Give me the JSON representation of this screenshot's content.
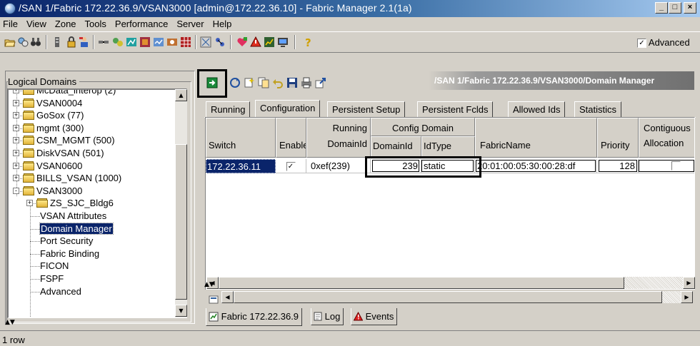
{
  "window": {
    "title": "/SAN 1/Fabric 172.22.36.9/VSAN3000 [admin@172.22.36.10] - Fabric Manager 2.1(1a)",
    "minimize": "_",
    "maximize": "□",
    "close": "×"
  },
  "menubar": {
    "items": [
      "File",
      "View",
      "Zone",
      "Tools",
      "Performance",
      "Server",
      "Help"
    ]
  },
  "toolbar": {
    "advanced_label": "Advanced",
    "advanced_checked": "✓"
  },
  "left_panel": {
    "title": "Logical Domains",
    "tree": [
      {
        "label": "McData_interop (2)",
        "level": 1,
        "expander": "+"
      },
      {
        "label": "VSAN0004",
        "level": 1,
        "expander": "+"
      },
      {
        "label": "GoSox (77)",
        "level": 1,
        "expander": "+"
      },
      {
        "label": "mgmt (300)",
        "level": 1,
        "expander": "+"
      },
      {
        "label": "CSM_MGMT (500)",
        "level": 1,
        "expander": "+"
      },
      {
        "label": "DiskVSAN (501)",
        "level": 1,
        "expander": "+"
      },
      {
        "label": "VSAN0600",
        "level": 1,
        "expander": "+"
      },
      {
        "label": "BILLS_VSAN (1000)",
        "level": 1,
        "expander": "+"
      },
      {
        "label": "VSAN3000",
        "level": 1,
        "expander": "-"
      },
      {
        "label": "ZS_SJC_Bldg6",
        "level": 2,
        "expander": "+"
      },
      {
        "label": "VSAN Attributes",
        "level": 2
      },
      {
        "label": "Domain Manager",
        "level": 2,
        "selected": true
      },
      {
        "label": "Port Security",
        "level": 2
      },
      {
        "label": "Fabric Binding",
        "level": 2
      },
      {
        "label": "FICON",
        "level": 2
      },
      {
        "label": "FSPF",
        "level": 2
      },
      {
        "label": "Advanced",
        "level": 2
      }
    ]
  },
  "right_panel": {
    "path_banner": "/SAN 1/Fabric 172.22.36.9/VSAN3000/Domain Manager",
    "tabs": [
      "Running",
      "Configuration",
      "Persistent Setup",
      "Persistent Fclds",
      "Allowed Ids",
      "Statistics"
    ],
    "active_tab": "Configuration",
    "table": {
      "headers": {
        "switch": "Switch",
        "enable": "Enable",
        "running_top": "Running",
        "running_domainid": "DomainId",
        "config_domain": "Config Domain",
        "config_domainid": "DomainId",
        "idtype": "IdType",
        "fabricname": "FabricName",
        "priority": "Priority",
        "contiguous_top": "Contiguous",
        "contiguous_bottom": "Allocation"
      },
      "rows": [
        {
          "switch": "172.22.36.11",
          "enable": "✓",
          "running_domainid": "0xef(239)",
          "config_domainid": "239",
          "idtype": "static",
          "fabricname": "20:01:00:05:30:00:28:df",
          "priority": "128",
          "contiguous": ""
        }
      ]
    },
    "bottom_tabs": [
      "Fabric 172.22.36.9",
      "Log",
      "Events"
    ]
  },
  "status": {
    "text": "1 row"
  },
  "colors": {
    "title_gradient_start": "#0a246a",
    "title_gradient_end": "#a6caf0",
    "selection": "#0a246a",
    "window_bg": "#d4d0c8"
  }
}
